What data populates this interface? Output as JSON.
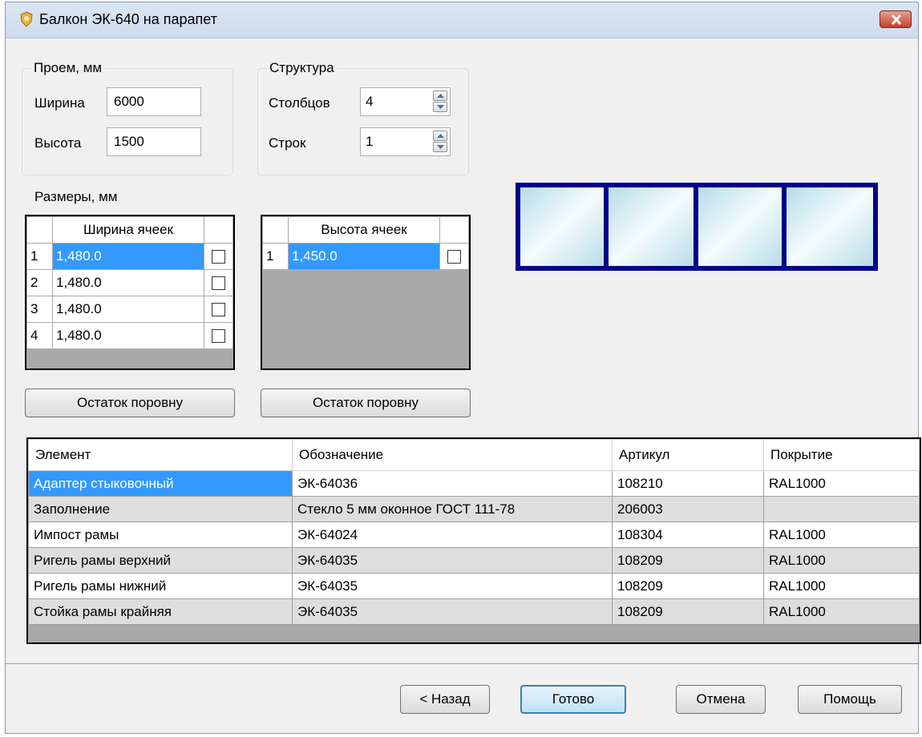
{
  "window": {
    "title": "Балкон ЭК-640 на парапет"
  },
  "opening": {
    "group_title": "Проем, мм",
    "width_label": "Ширина",
    "width_value": "6000",
    "height_label": "Высота",
    "height_value": "1500"
  },
  "structure": {
    "group_title": "Структура",
    "columns_label": "Столбцов",
    "columns_value": "4",
    "rows_label": "Строк",
    "rows_value": "1"
  },
  "sizes": {
    "label": "Размеры, мм",
    "width_grid": {
      "header": "Ширина ячеек",
      "rows": [
        {
          "index": "1",
          "value": "1,480.0"
        },
        {
          "index": "2",
          "value": "1,480.0"
        },
        {
          "index": "3",
          "value": "1,480.0"
        },
        {
          "index": "4",
          "value": "1,480.0"
        }
      ]
    },
    "height_grid": {
      "header": "Высота ячеек",
      "rows": [
        {
          "index": "1",
          "value": "1,450.0"
        }
      ]
    },
    "width_remainder_button": "Остаток поровну",
    "height_remainder_button": "Остаток поровну"
  },
  "preview": {
    "columns": 4,
    "rows": 1,
    "frame_color": "#00008b",
    "glass_color": "#cfeaf0"
  },
  "elements_table": {
    "headers": [
      "Элемент",
      "Обозначение",
      "Артикул",
      "Покрытие"
    ],
    "rows": [
      {
        "element": "Адаптер стыковочный",
        "designation": "ЭК-64036",
        "article": "108210",
        "coating": "RAL1000"
      },
      {
        "element": "Заполнение",
        "designation": "Стекло 5 мм оконное ГОСТ 111-78",
        "article": "206003",
        "coating": ""
      },
      {
        "element": "Импост рамы",
        "designation": "ЭК-64024",
        "article": "108304",
        "coating": "RAL1000"
      },
      {
        "element": "Ригель рамы верхний",
        "designation": "ЭК-64035",
        "article": "108209",
        "coating": "RAL1000"
      },
      {
        "element": "Ригель рамы нижний",
        "designation": "ЭК-64035",
        "article": "108209",
        "coating": "RAL1000"
      },
      {
        "element": "Стойка рамы крайняя",
        "designation": "ЭК-64035",
        "article": "108209",
        "coating": "RAL1000"
      }
    ]
  },
  "footer": {
    "back": "< Назад",
    "finish": "Готово",
    "cancel": "Отмена",
    "help": "Помощь"
  }
}
